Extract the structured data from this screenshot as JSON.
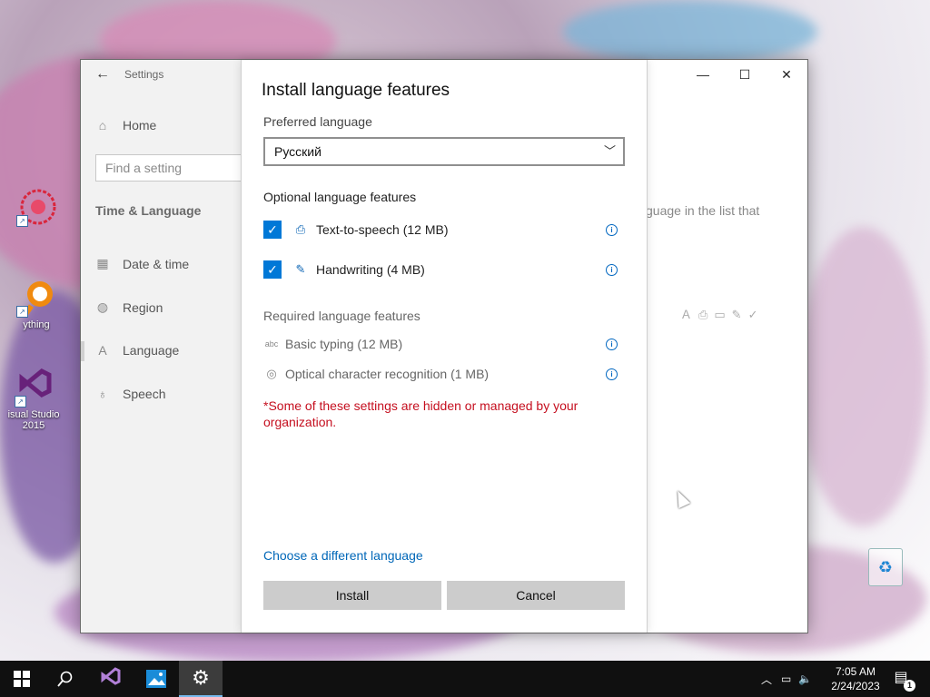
{
  "desktop": {
    "icons": [
      {
        "label": ""
      },
      {
        "label": "ything"
      },
      {
        "label": "isual Studio 2015"
      }
    ]
  },
  "window": {
    "title": "Settings",
    "controls": {
      "minimize": "—",
      "maximize": "☐",
      "close": "✕"
    },
    "back_glyph": "←",
    "sidebar": {
      "home": "Home",
      "search_placeholder": "Find a setting",
      "section": "Time & Language",
      "items": [
        {
          "label": "Date & time",
          "icon": "calendar-icon"
        },
        {
          "label": "Region",
          "icon": "globe-icon"
        },
        {
          "label": "Language",
          "icon": "language-icon"
        },
        {
          "label": "Speech",
          "icon": "microphone-icon"
        }
      ]
    },
    "background_text": "guage in the list that"
  },
  "dialog": {
    "title": "Install language features",
    "preferred_label": "Preferred language",
    "preferred_value": "Русский",
    "optional_label": "Optional language features",
    "optional": [
      {
        "label": "Text-to-speech (12 MB)",
        "checked": true,
        "icon": "speech-icon"
      },
      {
        "label": "Handwriting (4 MB)",
        "checked": true,
        "icon": "handwriting-icon"
      }
    ],
    "required_label": "Required language features",
    "required": [
      {
        "label": "Basic typing (12 MB)",
        "icon": "typing-icon"
      },
      {
        "label": "Optical character recognition (1 MB)",
        "icon": "ocr-icon"
      }
    ],
    "warning": "*Some of these settings are hidden or managed by your organization.",
    "link": "Choose a different language",
    "install": "Install",
    "cancel": "Cancel"
  },
  "taskbar": {
    "time": "7:05 AM",
    "date": "2/24/2023",
    "notification_count": "1"
  },
  "colors": {
    "accent": "#0078d7",
    "warning": "#c50f1f",
    "link": "#0067b8"
  }
}
